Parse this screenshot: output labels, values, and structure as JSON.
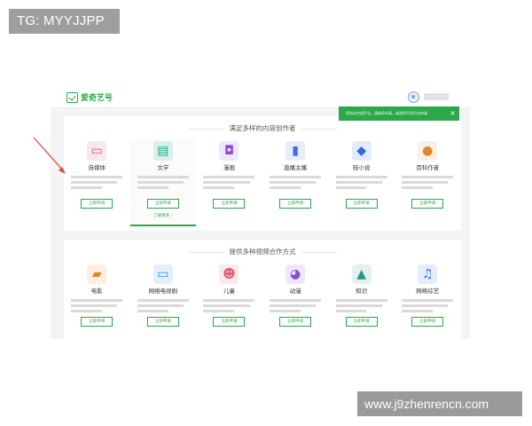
{
  "watermarks": {
    "tg": "TG: MYYJJPP",
    "site": "www.j9zhenrencn.com"
  },
  "header": {
    "logo_text": "爱奇艺号"
  },
  "toast": {
    "text": "您尚未完成开号。请继续申请，或选择不同方向申请",
    "close": "×"
  },
  "sections": [
    {
      "title": "满足多样的内容创作者",
      "cards": [
        {
          "title": "自媒体",
          "icon": "tv-icon",
          "color": "#e04a6c",
          "glyph": "▭",
          "button": "立即申请"
        },
        {
          "title": "文学",
          "icon": "book-icon",
          "color": "#1fa88a",
          "glyph": "▤",
          "button": "立即申请",
          "link": "了解更多 ›"
        },
        {
          "title": "漫画",
          "icon": "comic-icon",
          "color": "#8a4bd6",
          "glyph": "◘",
          "button": "立即申请"
        },
        {
          "title": "直播主播",
          "icon": "mic-icon",
          "color": "#3d6fe0",
          "glyph": "▮",
          "button": "立即申请"
        },
        {
          "title": "轻小说",
          "icon": "novel-icon",
          "color": "#2f6ad6",
          "glyph": "◆",
          "button": "立即申请"
        },
        {
          "title": "百科作者",
          "icon": "planet-icon",
          "color": "#e0852b",
          "glyph": "●",
          "button": "立即申请"
        }
      ]
    },
    {
      "title": "提供多种视频合作方式",
      "cards": [
        {
          "title": "电影",
          "icon": "clapper-icon",
          "color": "#e0852b",
          "glyph": "▰",
          "button": "立即申请"
        },
        {
          "title": "网络电视剧",
          "icon": "monitor-icon",
          "color": "#2f8fe0",
          "glyph": "▭",
          "button": "立即申请"
        },
        {
          "title": "儿童",
          "icon": "kid-icon",
          "color": "#e0607a",
          "glyph": "☻",
          "button": "立即申请"
        },
        {
          "title": "动漫",
          "icon": "monster-icon",
          "color": "#8a4bd6",
          "glyph": "◕",
          "button": "立即申请"
        },
        {
          "title": "知识",
          "icon": "compass-icon",
          "color": "#1f9a8a",
          "glyph": "▲",
          "button": "立即申请"
        },
        {
          "title": "网络综艺",
          "icon": "microphone-icon",
          "color": "#3d6fe0",
          "glyph": "♫",
          "button": "立即申请"
        }
      ]
    }
  ]
}
